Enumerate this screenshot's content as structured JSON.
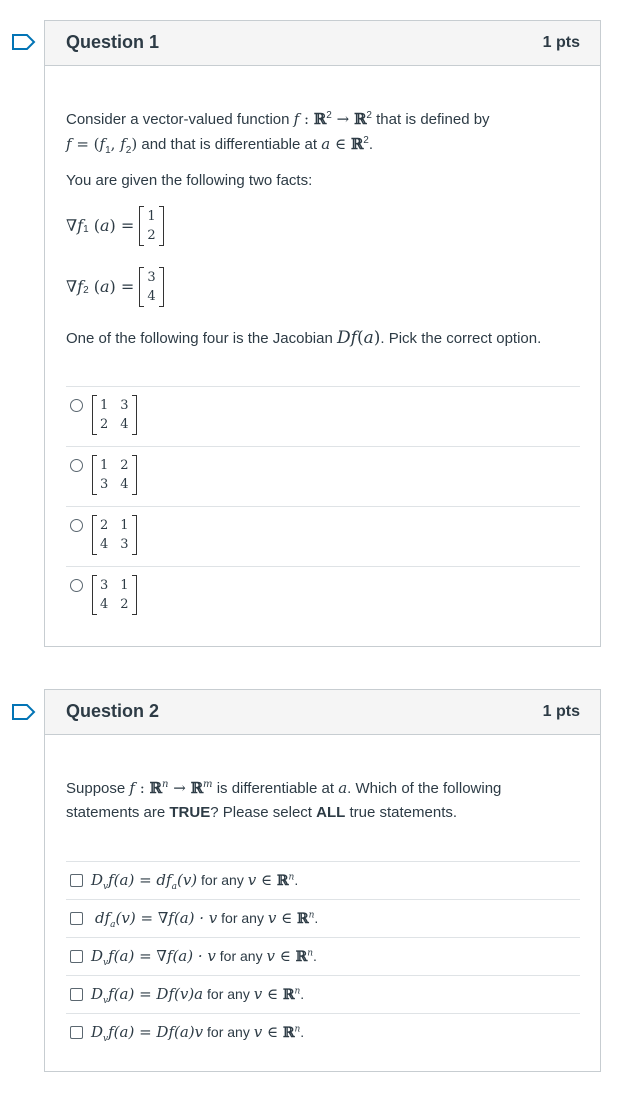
{
  "questions": [
    {
      "title": "Question 1",
      "points": "1 pts",
      "intro_1": "Consider a vector-valued function",
      "intro_1_tail": "that is defined by",
      "intro_2_tail": "and that is differentiable at",
      "given_text": "You are given the following two facts:",
      "grad1_vector": [
        "1",
        "2"
      ],
      "grad2_vector": [
        "3",
        "4"
      ],
      "prompt_pre": "One of the following four is the Jacobian",
      "prompt_post": ". Pick the correct option.",
      "options": [
        {
          "matrix": [
            [
              "1",
              "3"
            ],
            [
              "2",
              "4"
            ]
          ]
        },
        {
          "matrix": [
            [
              "1",
              "2"
            ],
            [
              "3",
              "4"
            ]
          ]
        },
        {
          "matrix": [
            [
              "2",
              "1"
            ],
            [
              "4",
              "3"
            ]
          ]
        },
        {
          "matrix": [
            [
              "3",
              "1"
            ],
            [
              "4",
              "2"
            ]
          ]
        }
      ]
    },
    {
      "title": "Question 2",
      "points": "1 pts",
      "stem_1a": "Suppose",
      "stem_1b": "is differentiable at",
      "stem_1c": ". Which of the following",
      "stem_2a": "statements are",
      "stem_2_true": "TRUE",
      "stem_2b": "? Please select",
      "stem_2_all": "ALL",
      "stem_2c": "true statements.",
      "options_suffix": "for any",
      "options": [
        {
          "lhs": "D",
          "lhs_sub": "v",
          "lhs_tail": "f(a) = df",
          "rhs_sub": "a",
          "rhs_tail": "(v)"
        },
        {
          "lhs": "df",
          "lhs_sub": "a",
          "lhs_tail": "(v) = ∇f(a) · v",
          "rhs_sub": "",
          "rhs_tail": ""
        },
        {
          "lhs": "D",
          "lhs_sub": "v",
          "lhs_tail": "f(a) = ∇f(a) · v",
          "rhs_sub": "",
          "rhs_tail": ""
        },
        {
          "lhs": "D",
          "lhs_sub": "v",
          "lhs_tail": "f(a) = Df(v)a",
          "rhs_sub": "",
          "rhs_tail": ""
        },
        {
          "lhs": "D",
          "lhs_sub": "v",
          "lhs_tail": "f(a) = Df(a)v",
          "rhs_sub": "",
          "rhs_tail": ""
        }
      ]
    }
  ],
  "colors": {
    "flag": "#0374b5",
    "header_bg": "#f5f5f5",
    "border": "#c7cdd1",
    "text": "#2d3b45"
  }
}
